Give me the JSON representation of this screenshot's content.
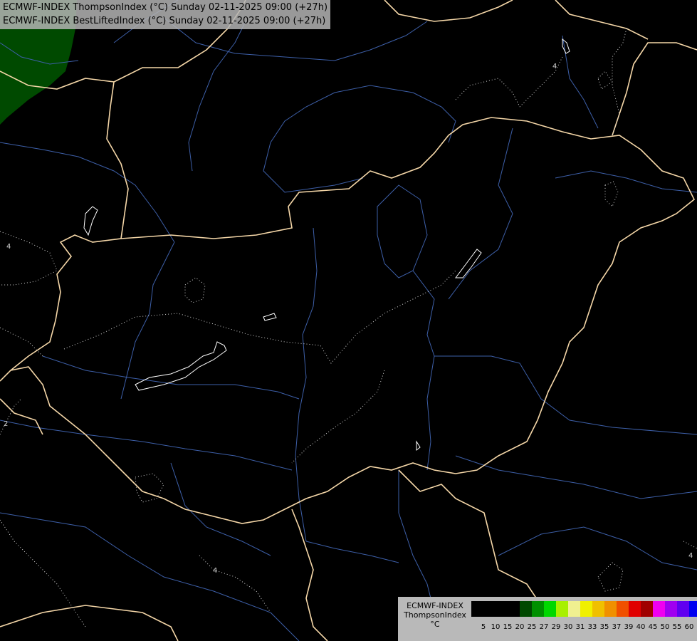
{
  "header": {
    "line1": "ECMWF-INDEX ThompsonIndex (°C) Sunday 02-11-2025 09:00 (+27h)",
    "line2": "ECMWF-INDEX BestLiftedIndex (°C) Sunday 02-11-2025 09:00 (+27h)"
  },
  "legend": {
    "title1": "ECMWF-INDEX",
    "title2": "ThompsonIndex",
    "unit": "°C",
    "ticks": [
      "5",
      "10",
      "15",
      "20",
      "25",
      "27",
      "29",
      "30",
      "31",
      "33",
      "35",
      "37",
      "39",
      "40",
      "45",
      "50",
      "55",
      "60"
    ],
    "colors": [
      "#000000",
      "#000000",
      "#000000",
      "#000000",
      "#004800",
      "#009000",
      "#00d800",
      "#a8f000",
      "#f0f090",
      "#f0f000",
      "#f0c000",
      "#f09000",
      "#f05000",
      "#e00000",
      "#a00000",
      "#f000f0",
      "#a000f0",
      "#6000f0",
      "#0000f0"
    ]
  },
  "contour_labels": [
    "4",
    "4",
    "2",
    "4",
    "4"
  ],
  "map_colors": {
    "background": "#000000",
    "border": "#f5d7a8",
    "river": "#3d5fa8",
    "contour": "#d0d0d0",
    "fill_region": "#004a00"
  }
}
